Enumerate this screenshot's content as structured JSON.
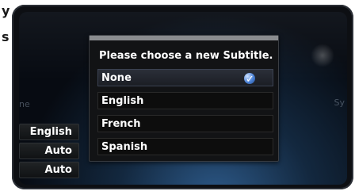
{
  "corner_glyphs": {
    "top": "y",
    "middle": "s"
  },
  "background_hints": {
    "left_text": "ne",
    "right_text": "Sy"
  },
  "left_panel": {
    "items": [
      {
        "label": "English"
      },
      {
        "label": "Auto"
      },
      {
        "label": "Auto"
      }
    ]
  },
  "dialog": {
    "title": "Please choose a new Subtitle.",
    "options": [
      {
        "label": "None",
        "selected": true
      },
      {
        "label": "English",
        "selected": false
      },
      {
        "label": "French",
        "selected": false
      },
      {
        "label": "Spanish",
        "selected": false
      }
    ]
  },
  "colors": {
    "accent_blue": "#4b82d6",
    "panel_border": "#3a3d42"
  },
  "icons": {
    "selected_icon": "checkmark-badge-icon"
  }
}
